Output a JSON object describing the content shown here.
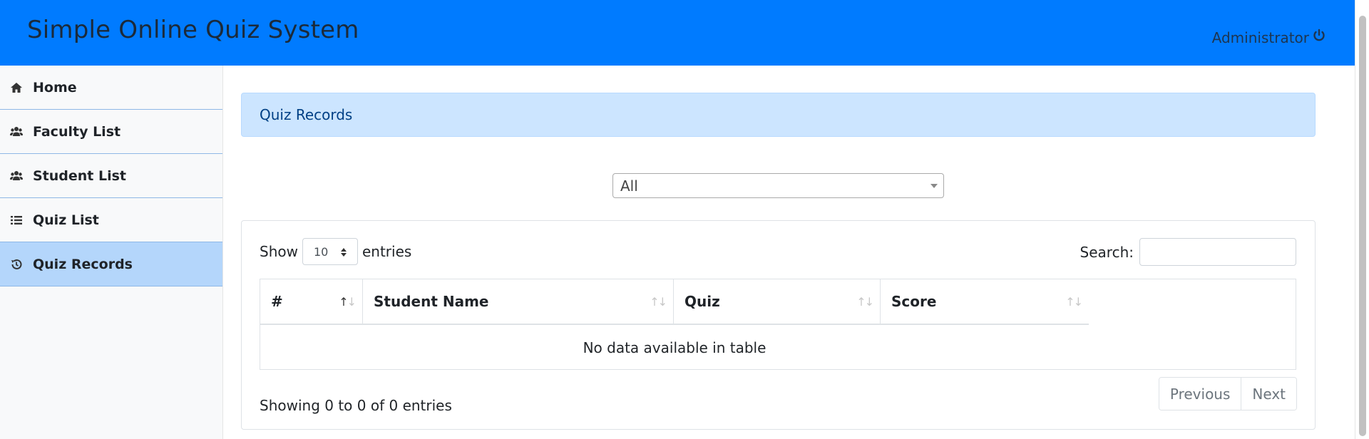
{
  "header": {
    "brand": "Simple Online Quiz System",
    "user_label": "Administrator",
    "user_icon": "power-icon"
  },
  "sidebar": {
    "items": [
      {
        "label": "Home",
        "icon": "home-icon",
        "active": false
      },
      {
        "label": "Faculty List",
        "icon": "users-icon",
        "active": false
      },
      {
        "label": "Student List",
        "icon": "users-icon",
        "active": false
      },
      {
        "label": "Quiz List",
        "icon": "list-icon",
        "active": false
      },
      {
        "label": "Quiz Records",
        "icon": "history-icon",
        "active": true
      }
    ]
  },
  "main": {
    "page_heading": "Quiz Records",
    "filter_select": {
      "selected": "All"
    },
    "table": {
      "show_label": "Show",
      "page_length": "10",
      "entries_label": "entries",
      "search_label": "Search:",
      "search_value": "",
      "columns": [
        "#",
        "Student Name",
        "Quiz",
        "Score"
      ],
      "empty_message": "No data available in table",
      "info": "Showing 0 to 0 of 0 entries",
      "pagination": {
        "previous": "Previous",
        "next": "Next"
      }
    }
  },
  "colors": {
    "navbar": "#007bff",
    "active_item": "#b4d6fb",
    "alert_bg": "#cce5ff",
    "alert_text": "#004085"
  }
}
